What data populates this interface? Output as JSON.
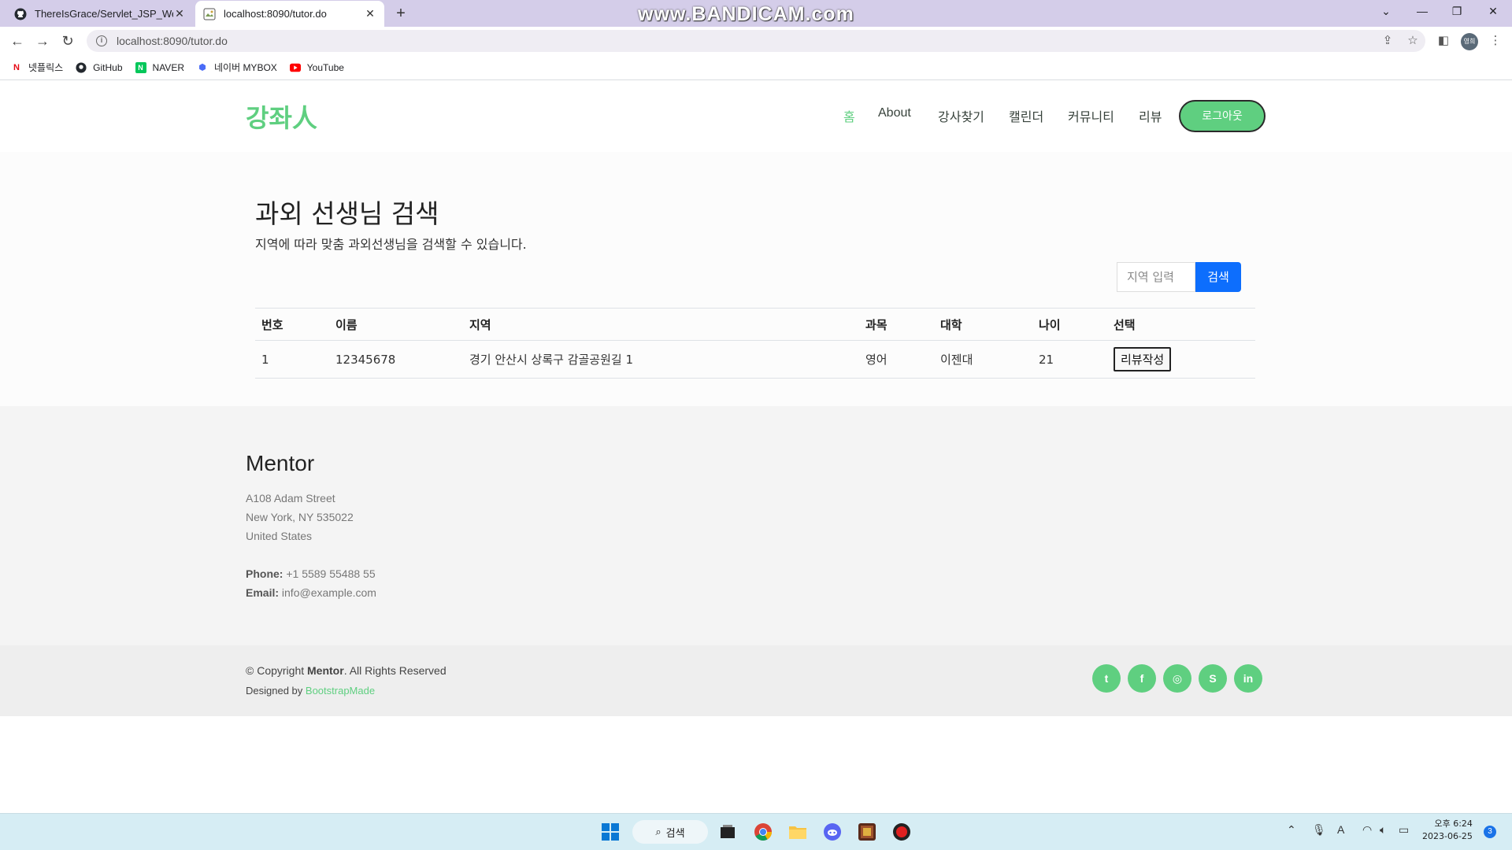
{
  "browser": {
    "tabs": [
      {
        "title": "ThereIsGrace/Servlet_JSP_WebS",
        "icon": "github-icon"
      },
      {
        "title": "localhost:8090/tutor.do",
        "icon": "page-icon"
      }
    ],
    "watermark": "www.BANDICAM.com",
    "url": "localhost:8090/tutor.do",
    "profile_label": "영희",
    "bookmarks": [
      {
        "label": "넷플릭스",
        "icon": "netflix-icon",
        "color": "#e50914"
      },
      {
        "label": "GitHub",
        "icon": "github-icon",
        "color": "#24292f"
      },
      {
        "label": "NAVER",
        "icon": "naver-icon",
        "color": "#03c75a"
      },
      {
        "label": "네이버 MYBOX",
        "icon": "mybox-icon",
        "color": "#4a6cf7"
      },
      {
        "label": "YouTube",
        "icon": "youtube-icon",
        "color": "#ff0000"
      }
    ]
  },
  "site": {
    "logo": "강좌人",
    "nav": [
      "홈",
      "About",
      "강사찾기",
      "캘린더",
      "커뮤니티",
      "리뷰"
    ],
    "logout": "로그아웃",
    "accent": "#5fcf80"
  },
  "search": {
    "title": "과외 선생님 검색",
    "subtitle": "지역에 따라 맞춤 과외선생님을 검색할 수 있습니다.",
    "placeholder": "지역 입력",
    "button": "검색"
  },
  "table": {
    "headers": [
      "번호",
      "이름",
      "지역",
      "과목",
      "대학",
      "나이",
      "선택"
    ],
    "rows": [
      {
        "no": "1",
        "name": "12345678",
        "region": "경기 안산시 상록구 감골공원길 1",
        "subject": "영어",
        "univ": "이젠대",
        "age": "21",
        "action": "리뷰작성"
      }
    ]
  },
  "footer": {
    "brand": "Mentor",
    "address1": "A108 Adam Street",
    "address2": "New York, NY 535022",
    "address3": "United States",
    "phone_label": "Phone:",
    "phone": "+1 5589 55488 55",
    "email_label": "Email:",
    "email": "info@example.com",
    "copyright_prefix": "© Copyright",
    "copyright_brand": "Mentor",
    "copyright_suffix": ". All Rights Reserved",
    "designed_prefix": "Designed by",
    "designed_link": "BootstrapMade",
    "social": [
      {
        "icon": "twitter-icon",
        "glyph": "t"
      },
      {
        "icon": "facebook-icon",
        "glyph": "f"
      },
      {
        "icon": "instagram-icon",
        "glyph": "◎"
      },
      {
        "icon": "skype-icon",
        "glyph": "S"
      },
      {
        "icon": "linkedin-icon",
        "glyph": "in"
      }
    ]
  },
  "taskbar": {
    "search_label": "검색",
    "clock_time": "오후 6:24",
    "clock_date": "2023-06-25",
    "notifications": "3",
    "ime": "A"
  }
}
